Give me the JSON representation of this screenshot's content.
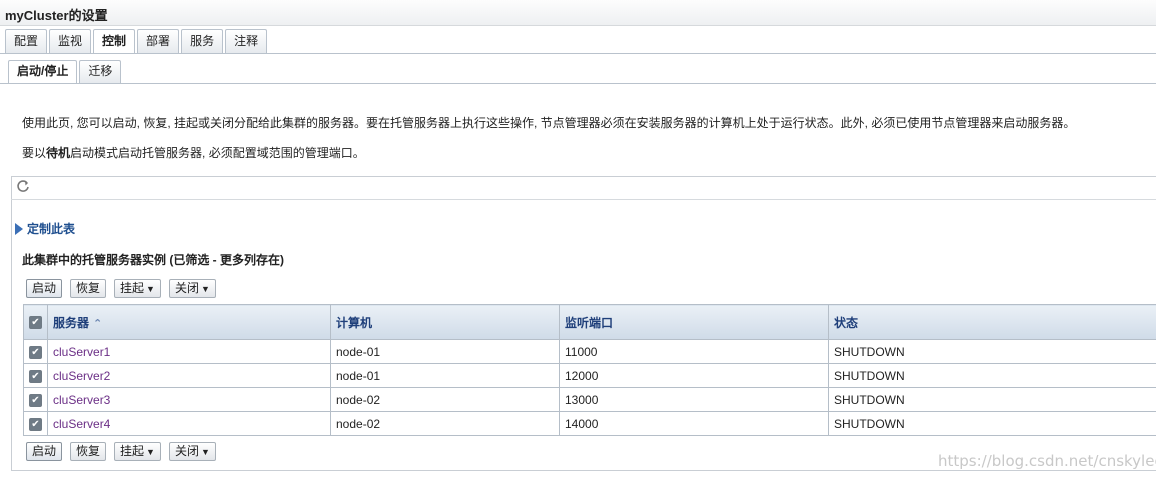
{
  "window": {
    "title": "myCluster的设置"
  },
  "tabs_main": [
    {
      "label": "配置",
      "active": false
    },
    {
      "label": "监视",
      "active": false
    },
    {
      "label": "控制",
      "active": true
    },
    {
      "label": "部署",
      "active": false
    },
    {
      "label": "服务",
      "active": false
    },
    {
      "label": "注释",
      "active": false
    }
  ],
  "tabs_sub": [
    {
      "label": "启动/停止",
      "active": true
    },
    {
      "label": "迁移",
      "active": false
    }
  ],
  "description": {
    "line1": "使用此页, 您可以启动, 恢复, 挂起或关闭分配给此集群的服务器。要在托管服务器上执行这些操作, 节点管理器必须在安装服务器的计算机上处于运行状态。此外, 必须已使用节点管理器来启动服务器。",
    "line2_prefix": "要以",
    "line2_bold": "待机",
    "line2_suffix": "启动模式启动托管服务器, 必须配置域范围的管理端口。"
  },
  "toolbar": {
    "refresh_icon": "refresh-icon"
  },
  "customize": {
    "label": "定制此表"
  },
  "table_caption": "此集群中的托管服务器实例 (已筛选 - 更多列存在)",
  "buttons": {
    "start": "启动",
    "resume": "恢复",
    "suspend": "挂起",
    "shutdown": "关闭"
  },
  "table": {
    "headers": [
      "服务器",
      "计算机",
      "监听端口",
      "状态"
    ],
    "rows": [
      {
        "server": "cluServer1",
        "machine": "node-01",
        "port": "11000",
        "state": "SHUTDOWN",
        "checked": true
      },
      {
        "server": "cluServer2",
        "machine": "node-01",
        "port": "12000",
        "state": "SHUTDOWN",
        "checked": true
      },
      {
        "server": "cluServer3",
        "machine": "node-02",
        "port": "13000",
        "state": "SHUTDOWN",
        "checked": true
      },
      {
        "server": "cluServer4",
        "machine": "node-02",
        "port": "14000",
        "state": "SHUTDOWN",
        "checked": true
      }
    ]
  },
  "watermark": "https://blog.csdn.net/cnskylee",
  "colors": {
    "header_text": "#1f3f7a",
    "link": "#6b2f86",
    "accent": "#3b6fb6"
  }
}
